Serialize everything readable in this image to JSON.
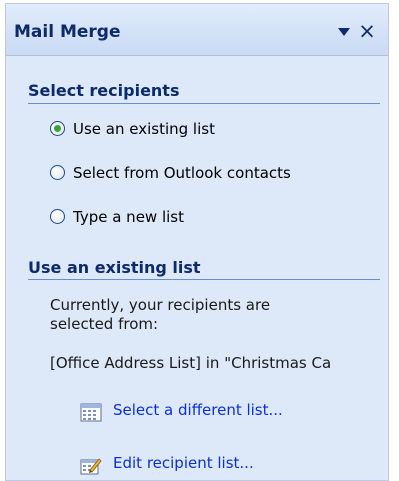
{
  "pane": {
    "title": "Mail Merge",
    "dropdown_icon": "dropdown-arrow",
    "close_icon": "close-x",
    "close_glyph": "×"
  },
  "select_recipients": {
    "header": "Select recipients",
    "options": [
      {
        "label": "Use an existing list",
        "selected": true
      },
      {
        "label": "Select from Outlook contacts",
        "selected": false
      },
      {
        "label": "Type a new list",
        "selected": false
      }
    ]
  },
  "existing_list": {
    "header": "Use an existing list",
    "description_line1": "Currently, your recipients are",
    "description_line2": "selected from:",
    "source": "[Office Address List] in \"Christmas Ca",
    "actions": [
      {
        "label": "Select a different list...",
        "icon": "address-book-icon"
      },
      {
        "label": "Edit recipient list...",
        "icon": "edit-list-icon"
      }
    ]
  },
  "colors": {
    "pane_background": "#dde8f8",
    "header_text": "#0d2a6b",
    "link_text": "#0b2fd8",
    "radio_selected": "#36a532"
  }
}
